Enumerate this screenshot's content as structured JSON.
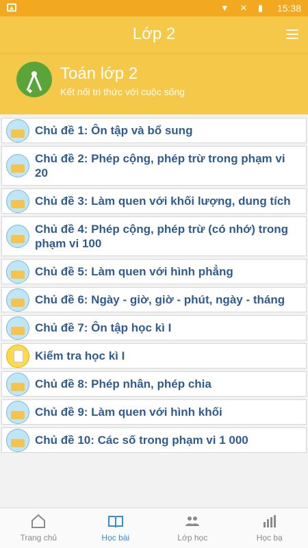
{
  "status": {
    "time": "15:38"
  },
  "appbar": {
    "title": "Lớp 2"
  },
  "subject": {
    "title": "Toán lớp 2",
    "subtitle": "Kết nối tri thức với cuộc sống"
  },
  "list": [
    {
      "label": "Chủ đề 1: Ôn tập và bổ sung",
      "icon": "folder"
    },
    {
      "label": "Chủ đề 2: Phép cộng, phép trừ trong phạm vi 20",
      "icon": "folder"
    },
    {
      "label": "Chủ đề 3: Làm quen với khối lượng, dung tích",
      "icon": "folder"
    },
    {
      "label": "Chủ đề 4: Phép cộng, phép trừ (có nhớ) trong phạm vi 100",
      "icon": "folder"
    },
    {
      "label": "Chủ đề 5: Làm quen với hình phẳng",
      "icon": "folder"
    },
    {
      "label": "Chủ đề 6: Ngày - giờ, giờ - phút, ngày - tháng",
      "icon": "folder"
    },
    {
      "label": "Chủ đề 7: Ôn tập học kì I",
      "icon": "folder"
    },
    {
      "label": "Kiểm tra học kì I",
      "icon": "test"
    },
    {
      "label": "Chủ đề 8: Phép nhân, phép chia",
      "icon": "folder"
    },
    {
      "label": "Chủ đề 9: Làm quen với hình khối",
      "icon": "folder"
    },
    {
      "label": "Chủ đề 10: Các số trong phạm vi 1 000",
      "icon": "folder"
    }
  ],
  "bottom_nav": [
    {
      "label": "Trang chủ",
      "icon": "home-icon",
      "active": false
    },
    {
      "label": "Học bài",
      "icon": "book-icon",
      "active": true
    },
    {
      "label": "Lớp học",
      "icon": "users-icon",
      "active": false
    },
    {
      "label": "Học bạ",
      "icon": "chart-icon",
      "active": false
    }
  ]
}
